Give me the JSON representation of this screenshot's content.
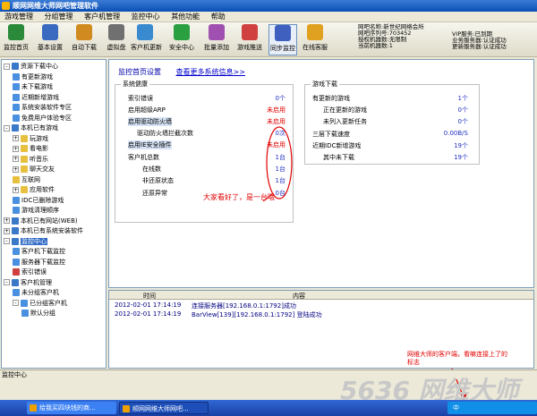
{
  "window": {
    "title": "顺网网维大师网吧管理软件"
  },
  "menu": [
    "游戏管理",
    "分组管理",
    "客户机管理",
    "监控中心",
    "其他功能",
    "帮助"
  ],
  "toolbar": [
    {
      "label": "监控首页",
      "icon": "monitor-icon",
      "color": "#2a8a3a"
    },
    {
      "label": "基本设置",
      "icon": "settings-icon",
      "color": "#3a6ac0"
    },
    {
      "label": "自动下载",
      "icon": "download-icon",
      "color": "#d08a20"
    },
    {
      "label": "虚拟盘",
      "icon": "disk-icon",
      "color": "#707070"
    },
    {
      "label": "客户机更新",
      "icon": "update-icon",
      "color": "#3a8ad0"
    },
    {
      "label": "安全中心",
      "icon": "shield-icon",
      "color": "#2aa040"
    },
    {
      "label": "批量添加",
      "icon": "add-icon",
      "color": "#a050b0"
    },
    {
      "label": "游戏推送",
      "icon": "push-icon",
      "color": "#d04040"
    },
    {
      "label": "同步监控",
      "icon": "sync-icon",
      "color": "#4060c0"
    },
    {
      "label": "在线客服",
      "icon": "support-icon",
      "color": "#e0a020"
    }
  ],
  "info": {
    "line1": "网吧名称:新世纪网络会所",
    "line2": "网吧序列号:703452",
    "line3": "授权机器数:无限制",
    "line4": "当前机器数:1",
    "vip_line": "VIP服务:已到期",
    "biz_line": "业务服务器:认证成功",
    "upd_line": "更新服务器:认证成功"
  },
  "tree": [
    {
      "label": "资源下载中心",
      "level": 0,
      "expander": "-",
      "color": "#3a78c8"
    },
    {
      "label": "有更新游戏",
      "level": 1,
      "color": "#4a90e0"
    },
    {
      "label": "未下载游戏",
      "level": 1,
      "color": "#4a90e0"
    },
    {
      "label": "近期新增游戏",
      "level": 1,
      "color": "#4a90e0"
    },
    {
      "label": "系统安装软件专区",
      "level": 1,
      "color": "#4a90e0"
    },
    {
      "label": "免费用户体验专区",
      "level": 1,
      "color": "#4a90e0"
    },
    {
      "label": "本机已有游戏",
      "level": 0,
      "expander": "-",
      "color": "#3a78c8"
    },
    {
      "label": "玩游戏",
      "level": 1,
      "expander": "+",
      "color": "#e8c040"
    },
    {
      "label": "看电影",
      "level": 1,
      "expander": "+",
      "color": "#e8c040"
    },
    {
      "label": "听音乐",
      "level": 1,
      "expander": "+",
      "color": "#e8c040"
    },
    {
      "label": "聊天交友",
      "level": 1,
      "expander": "+",
      "color": "#e8c040"
    },
    {
      "label": "互联网",
      "level": 1,
      "color": "#e8c040"
    },
    {
      "label": "应用软件",
      "level": 1,
      "expander": "+",
      "color": "#e8c040"
    },
    {
      "label": "IDC已删除游戏",
      "level": 1,
      "color": "#4a90e0"
    },
    {
      "label": "游戏清理顺序",
      "level": 1,
      "color": "#4a90e0"
    },
    {
      "label": "本机已有网站(WEB)",
      "level": 0,
      "expander": "+",
      "color": "#3a78c8"
    },
    {
      "label": "本机已有系统安装软件",
      "level": 0,
      "expander": "+",
      "color": "#3a78c8"
    },
    {
      "label": "监控中心",
      "level": 0,
      "expander": "-",
      "color": "#3a78c8",
      "selected": true
    },
    {
      "label": "客户机下载监控",
      "level": 1,
      "color": "#4a90e0"
    },
    {
      "label": "服务器下载监控",
      "level": 1,
      "color": "#4a90e0"
    },
    {
      "label": "索引错误",
      "level": 1,
      "color": "#d04040"
    },
    {
      "label": "客户机管理",
      "level": 0,
      "expander": "-",
      "color": "#3a78c8"
    },
    {
      "label": "未分组客户机",
      "level": 1,
      "color": "#4a90e0"
    },
    {
      "label": "已分组客户机",
      "level": 1,
      "expander": "-",
      "color": "#4a90e0"
    },
    {
      "label": "默认分组",
      "level": 2,
      "color": "#4a90e0"
    }
  ],
  "tabs": {
    "active": "监控首页设置",
    "link": "查看更多系统信息>>"
  },
  "health": {
    "title": "系统健康",
    "rows": [
      {
        "label": "索引错误",
        "value": "0个",
        "color": "blue"
      },
      {
        "label": "启用超级ARP",
        "value": "未启用",
        "color": "red"
      },
      {
        "label": "启用驱动防火墙",
        "value": "未启用",
        "color": "red"
      },
      {
        "label": "驱动防火墙拦截次数",
        "value": "0次",
        "color": "blue"
      },
      {
        "label": "启用IE安全插件",
        "value": "未启用",
        "color": "red"
      },
      {
        "label": "客户机总数",
        "value": "1台",
        "color": "blue"
      },
      {
        "label": "在线数",
        "value": "1台",
        "color": "blue"
      },
      {
        "label": "非还原状态",
        "value": "1台",
        "color": "blue"
      },
      {
        "label": "还原异常",
        "value": "0台",
        "color": "blue"
      }
    ]
  },
  "downloads": {
    "title": "游戏下载",
    "rows": [
      {
        "label": "有更新的游戏",
        "value": "1个"
      },
      {
        "label": "正在更新的游戏",
        "value": "0个"
      },
      {
        "label": "未列入更新任务",
        "value": "0个"
      },
      {
        "label": "三层下载速度",
        "value": "0.00B/S"
      },
      {
        "label": "近期IDC新增游戏",
        "value": "19个"
      },
      {
        "label": "其中未下载",
        "value": "19个"
      }
    ]
  },
  "log": {
    "col_time": "时间",
    "col_content": "内容",
    "rows": [
      {
        "time": "2012-02-01 17:14:19",
        "content": "连接服务器[192.168.0.1:1792]成功"
      },
      {
        "time": "2012-02-01 17:14:19",
        "content": "BarView[139][192.168.0.1:1792] 登陆成功"
      }
    ]
  },
  "statusbar": "监控中心",
  "taskbar": {
    "items": [
      "给我买四块钱的商...",
      "顺网网维大师网吧..."
    ],
    "tray_time": "中"
  },
  "annotations": {
    "a1": "大家看好了，是一台哦",
    "a2_line1": "网维大师的客户端，看嘛连接上了的",
    "a2_line2": "标志"
  },
  "watermark": "5636 网维大师"
}
